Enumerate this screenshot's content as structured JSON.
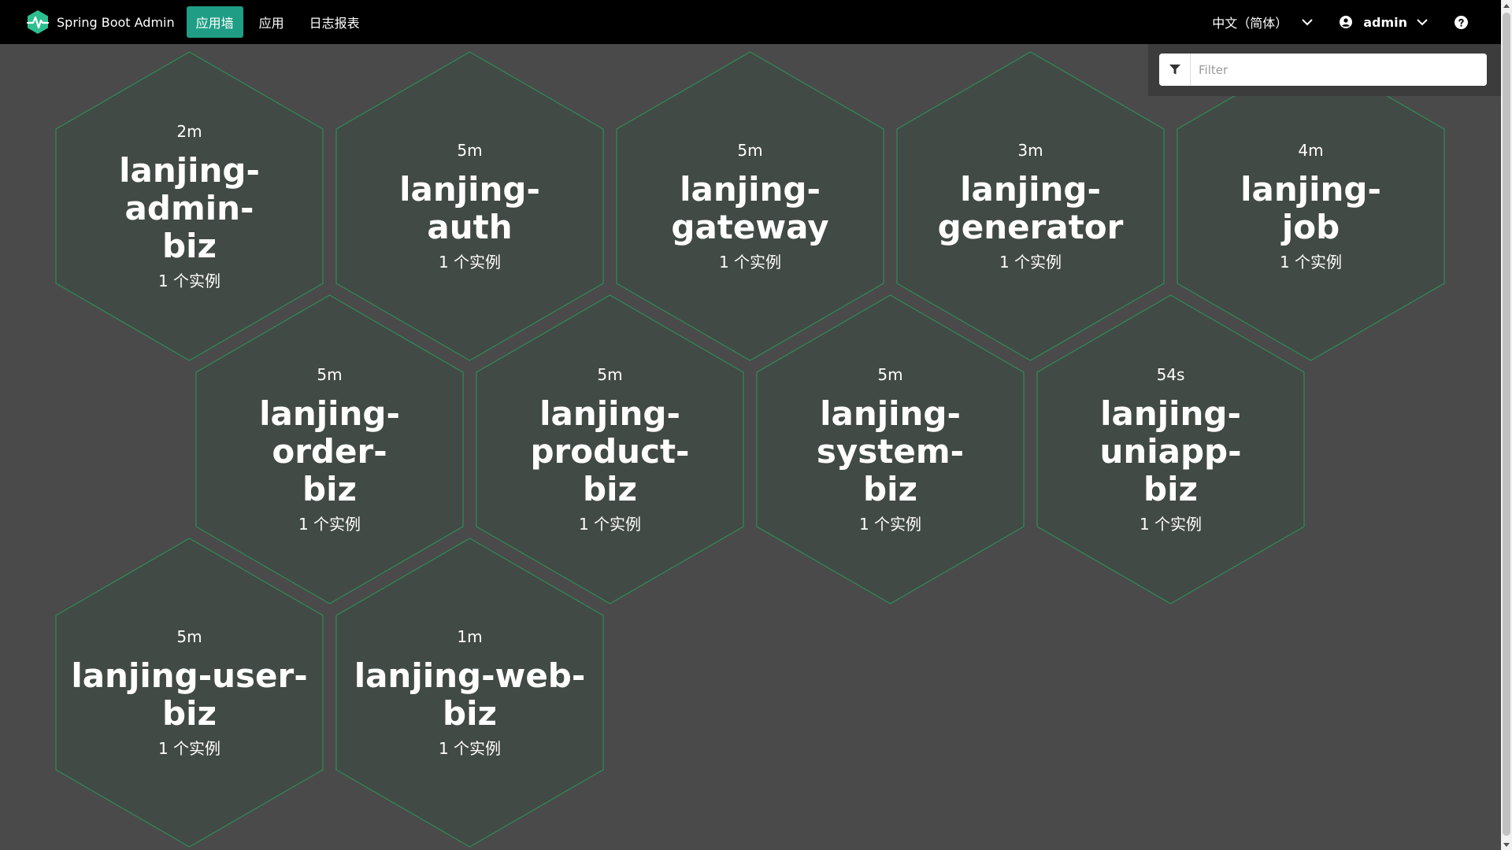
{
  "navbar": {
    "brand": "Spring Boot Admin",
    "tabs": [
      {
        "label": "应用墙",
        "active": true
      },
      {
        "label": "应用",
        "active": false
      },
      {
        "label": "日志报表",
        "active": false
      }
    ],
    "language": "中文（简体）",
    "user": "admin"
  },
  "filter": {
    "placeholder": "Filter",
    "value": ""
  },
  "colors": {
    "accent": "#1f9e85",
    "hex_fill": "#424a45",
    "hex_border": "#2f8a5a",
    "background": "#4a4a4a",
    "navbar": "#000000"
  },
  "applications": [
    {
      "age": "2m",
      "name": "lanjing-admin-biz",
      "instances": "1 个实例",
      "status": "up"
    },
    {
      "age": "5m",
      "name": "lanjing-auth",
      "instances": "1 个实例",
      "status": "up"
    },
    {
      "age": "5m",
      "name": "lanjing-gateway",
      "instances": "1 个实例",
      "status": "up"
    },
    {
      "age": "3m",
      "name": "lanjing-generator",
      "instances": "1 个实例",
      "status": "up"
    },
    {
      "age": "4m",
      "name": "lanjing-job",
      "instances": "1 个实例",
      "status": "up"
    },
    {
      "age": "5m",
      "name": "lanjing-order-biz",
      "instances": "1 个实例",
      "status": "up"
    },
    {
      "age": "5m",
      "name": "lanjing-product-biz",
      "instances": "1 个实例",
      "status": "up"
    },
    {
      "age": "5m",
      "name": "lanjing-system-biz",
      "instances": "1 个实例",
      "status": "up"
    },
    {
      "age": "54s",
      "name": "lanjing-uniapp-biz",
      "instances": "1 个实例",
      "status": "up"
    },
    {
      "age": "5m",
      "name": "lanjing-user-biz",
      "instances": "1 个实例",
      "status": "up"
    },
    {
      "age": "1m",
      "name": "lanjing-web-biz",
      "instances": "1 个实例",
      "status": "up"
    }
  ]
}
